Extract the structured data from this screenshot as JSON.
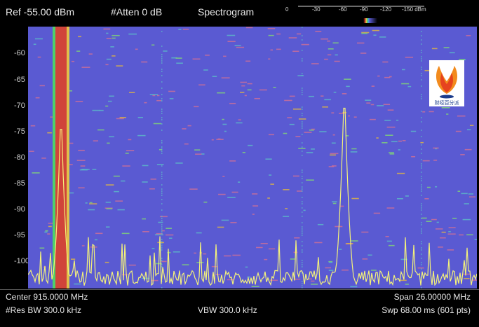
{
  "header": {
    "ref": "Ref -55.00 dBm",
    "atten": "#Atten 0 dB",
    "mode": "Spectrogram",
    "scale_ticks": [
      "0",
      "-30",
      "-60",
      "-90",
      "-120",
      "-150 dBm"
    ]
  },
  "y_axis": {
    "labels": [
      "-60",
      "-65",
      "-70",
      "-75",
      "-80",
      "-85",
      "-90",
      "-95",
      "-100"
    ]
  },
  "footer": {
    "center": "Center 915.0000 MHz",
    "span": "Span 26.00000 MHz",
    "res_bw": "#Res BW 300.0 kHz",
    "vbw": "VBW 300.0 kHz",
    "swp": "Swp 68.00 ms (601 pts)"
  },
  "logo": {
    "text": "财经百分派"
  },
  "colors": {
    "spectrogram_bg": "#5a5ad2",
    "trace": "#f4f27a",
    "hot": "#d0443a",
    "grid": "#7a7ad8"
  }
}
